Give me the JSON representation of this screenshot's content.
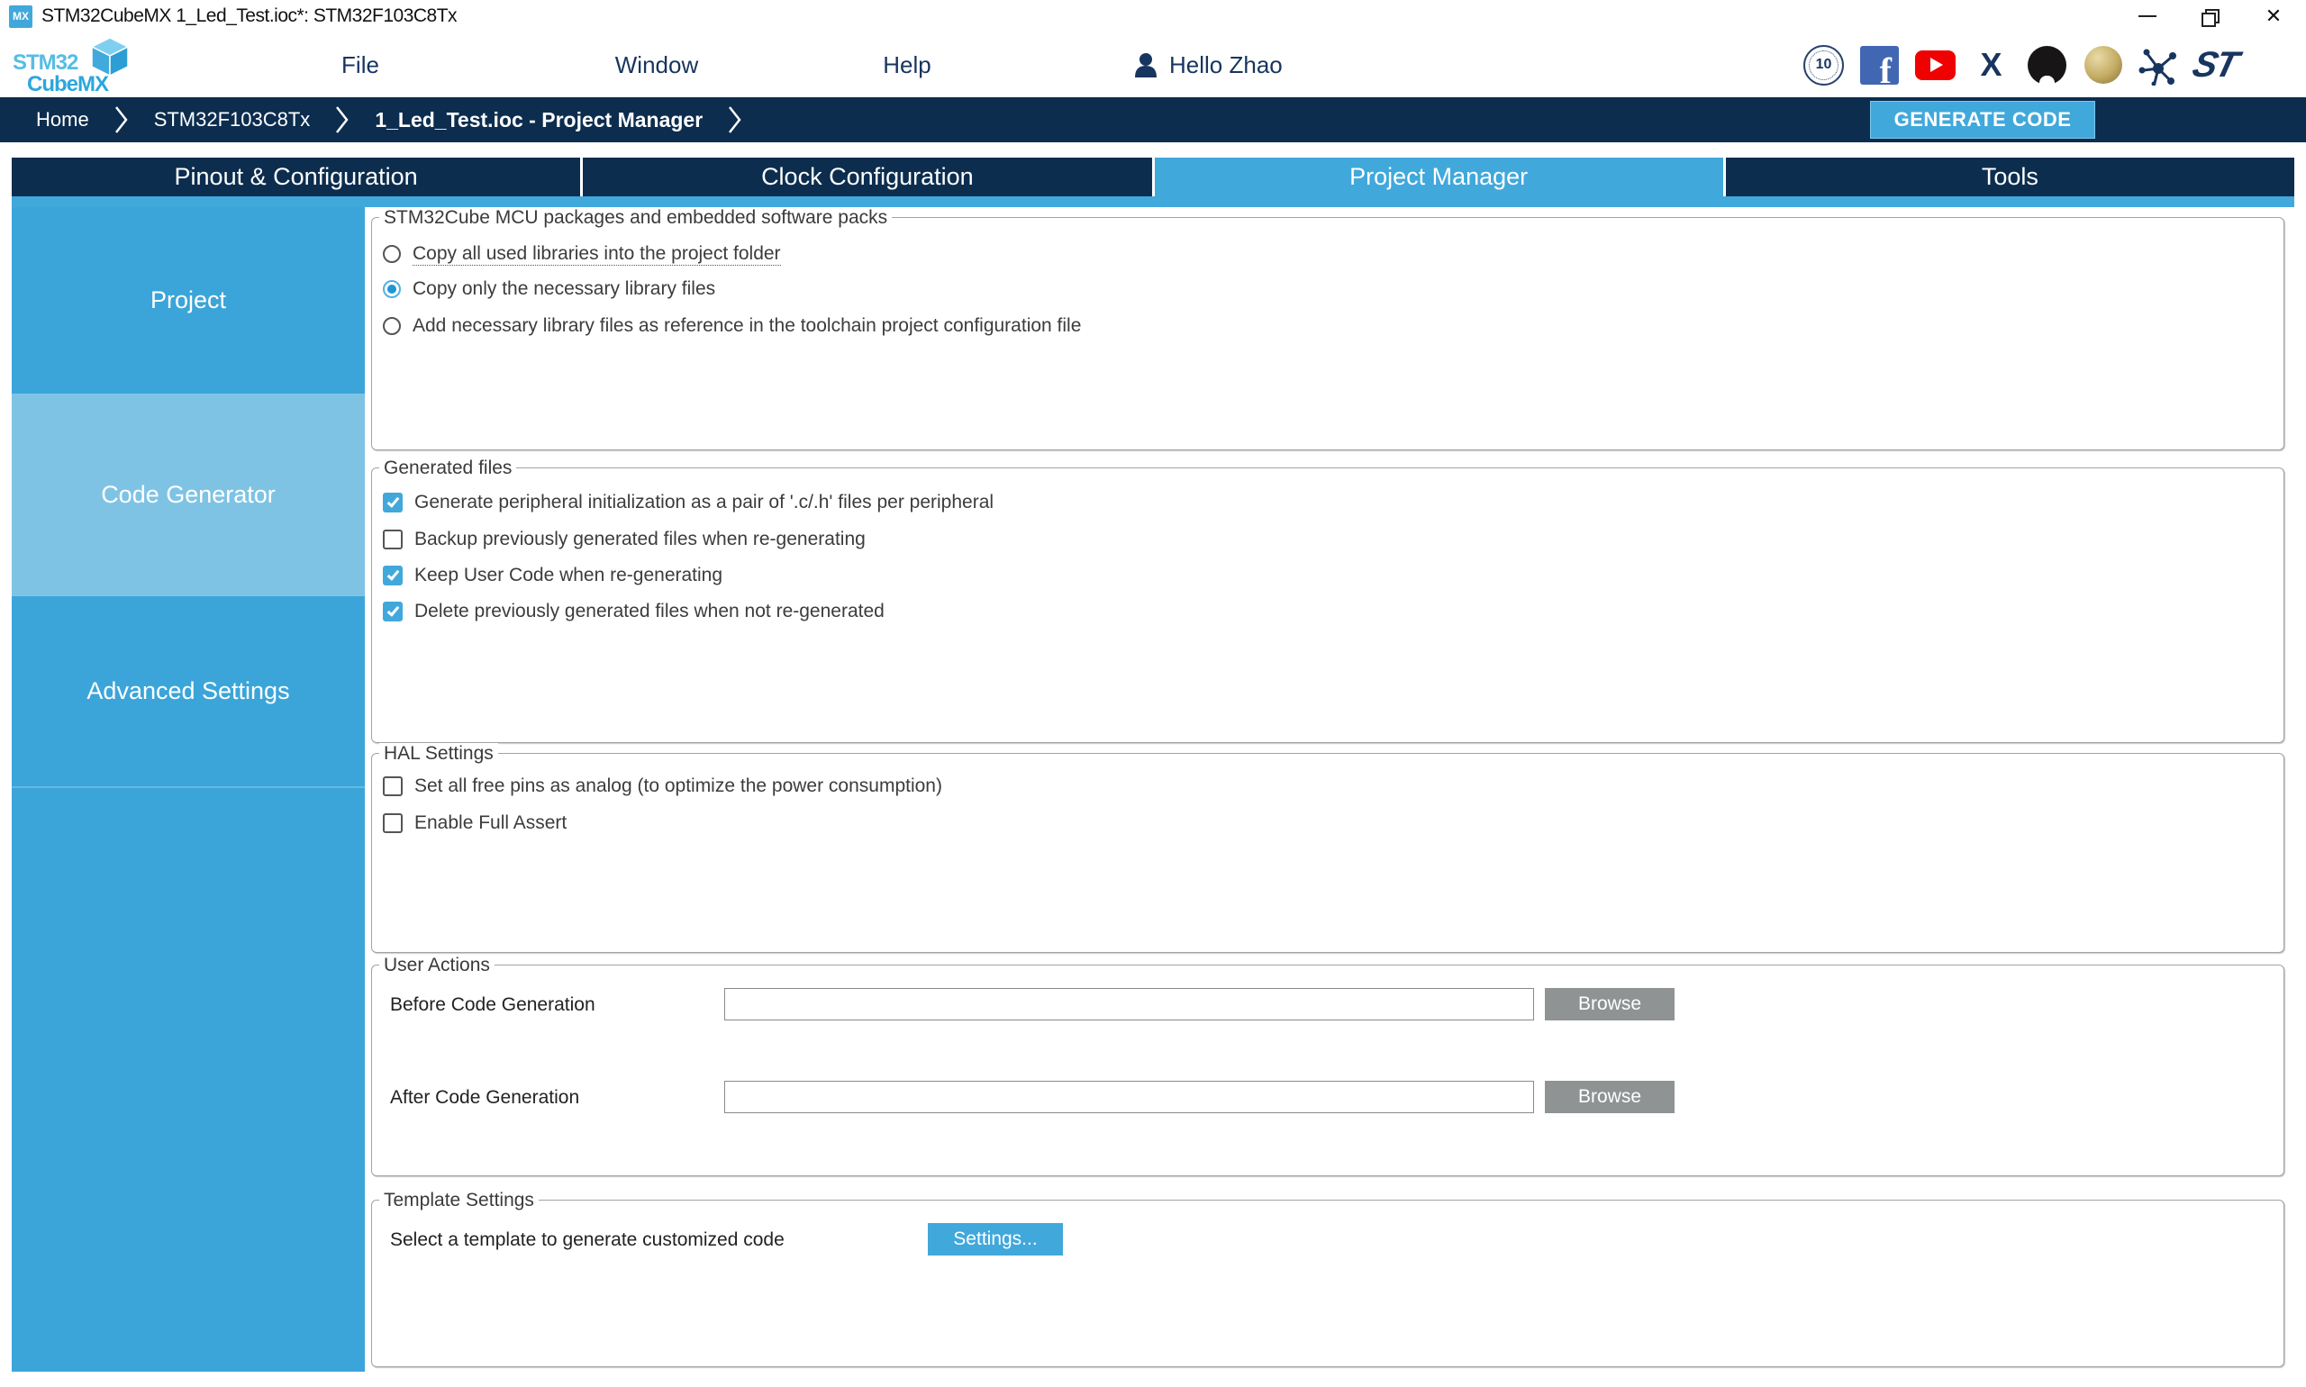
{
  "window": {
    "title": "STM32CubeMX 1_Led_Test.ioc*: STM32F103C8Tx",
    "app_icon_label": "MX"
  },
  "icons": {
    "close_glyph": "✕",
    "badge_text": "10",
    "facebook_letter": "f",
    "x_letter": "X",
    "st_text": "ST"
  },
  "menu": {
    "logo_top": "STM32",
    "logo_bottom": "CubeMX",
    "items": [
      "File",
      "Window",
      "Help"
    ],
    "user_greeting": "Hello Zhao"
  },
  "social_icons": [
    "10-years-badge",
    "facebook",
    "youtube",
    "x-twitter",
    "github",
    "wikipedia",
    "community-network",
    "st-logo"
  ],
  "breadcrumb": {
    "items": [
      "Home",
      "STM32F103C8Tx",
      "1_Led_Test.ioc - Project Manager"
    ],
    "generate_code_label": "GENERATE CODE"
  },
  "tabs": [
    {
      "label": "Pinout & Configuration",
      "active": false
    },
    {
      "label": "Clock Configuration",
      "active": false
    },
    {
      "label": "Project Manager",
      "active": true
    },
    {
      "label": "Tools",
      "active": false
    }
  ],
  "sidebar": {
    "items": [
      {
        "label": "Project",
        "selected": false
      },
      {
        "label": "Code Generator",
        "selected": true
      },
      {
        "label": "Advanced Settings",
        "selected": false
      }
    ]
  },
  "panels": {
    "mcu_packages": {
      "legend": "STM32Cube MCU packages and embedded software packs",
      "radios": [
        {
          "label": "Copy all used libraries into the project folder",
          "checked": false,
          "underlined": true
        },
        {
          "label": "Copy only the necessary library files",
          "checked": true,
          "underlined": false
        },
        {
          "label": "Add necessary library files as reference in the toolchain project configuration file",
          "checked": false,
          "underlined": false
        }
      ]
    },
    "generated_files": {
      "legend": "Generated files",
      "checkboxes": [
        {
          "label": "Generate peripheral initialization as a pair of '.c/.h' files per peripheral",
          "checked": true
        },
        {
          "label": "Backup previously generated files when re-generating",
          "checked": false
        },
        {
          "label": "Keep User Code when re-generating",
          "checked": true
        },
        {
          "label": "Delete previously generated files when not re-generated",
          "checked": true
        }
      ]
    },
    "hal_settings": {
      "legend": "HAL Settings",
      "checkboxes": [
        {
          "label": "Set all free pins as analog (to optimize the power consumption)",
          "checked": false
        },
        {
          "label": "Enable Full Assert",
          "checked": false
        }
      ]
    },
    "user_actions": {
      "legend": "User Actions",
      "rows": [
        {
          "label": "Before Code Generation",
          "value": "",
          "button": "Browse"
        },
        {
          "label": "After Code Generation",
          "value": "",
          "button": "Browse"
        }
      ]
    },
    "template_settings": {
      "legend": "Template Settings",
      "label": "Select a template to generate customized code",
      "button": "Settings..."
    }
  },
  "colors": {
    "accent_blue": "#41a8db",
    "navy": "#0c2d4e",
    "sidebar_blue": "#3ba5d9",
    "sidebar_selected": "#7fc3e4",
    "browse_gray": "#8f9394",
    "youtube_red": "#f00000",
    "facebook_blue": "#4267b2"
  }
}
